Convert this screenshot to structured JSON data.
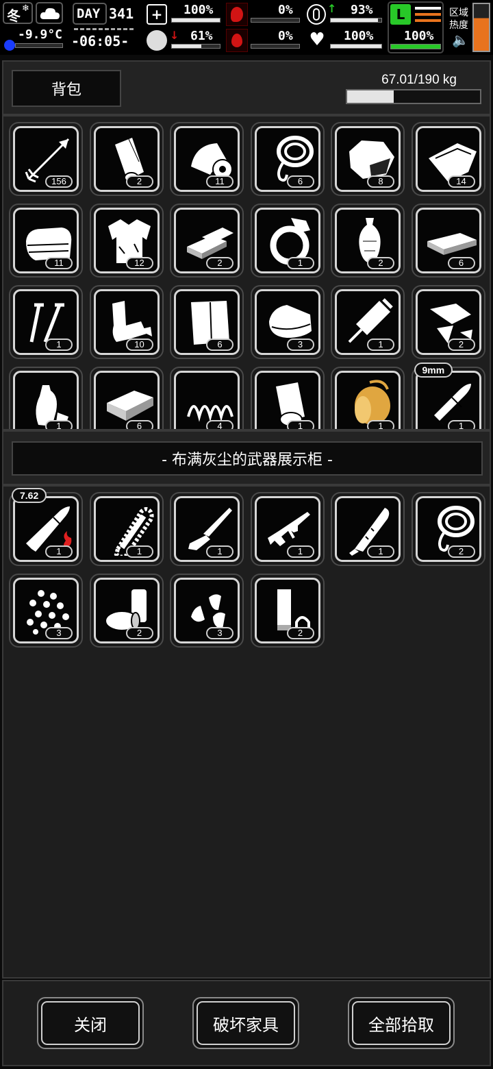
{
  "hud": {
    "season": "冬",
    "temperature": "-9.9°C",
    "day_label": "DAY",
    "day_number": "341",
    "clock": "-06:05-",
    "health_pct": "100%",
    "health_fill": 1.0,
    "hunger_pct": "0%",
    "hunger_fill": 0.0,
    "energy_pct": "93%",
    "energy_fill": 0.93,
    "brain_pct": "61%",
    "brain_fill": 0.61,
    "blood_pct": "0%",
    "blood_fill": 0.0,
    "heart_pct": "100%",
    "heart_fill": 1.0,
    "stamina_pct": "100%",
    "stamina_fill": 1.0,
    "zone_heat_label": "区域热度",
    "colors": {
      "green": "#28c828",
      "red": "#d21414",
      "orange": "#e8731e"
    }
  },
  "backpack": {
    "title": "背包",
    "weight": "67.01/190 kg",
    "weight_fill": 0.3527,
    "items": [
      {
        "icon": "arrow-icon",
        "count": "156"
      },
      {
        "icon": "bandage-roll-icon",
        "count": "2"
      },
      {
        "icon": "duct-tape-icon",
        "count": "11"
      },
      {
        "icon": "rope-icon",
        "count": "6"
      },
      {
        "icon": "ore-icon",
        "count": "8"
      },
      {
        "icon": "paper-stack-icon",
        "count": "14"
      },
      {
        "icon": "cloth-icon",
        "count": "11"
      },
      {
        "icon": "rag-shirt-icon",
        "count": "12"
      },
      {
        "icon": "silver-bar-icon",
        "count": "2"
      },
      {
        "icon": "diamond-ring-icon",
        "count": "1"
      },
      {
        "icon": "vase-icon",
        "count": "2"
      },
      {
        "icon": "cash-stack-icon",
        "count": "6"
      },
      {
        "icon": "screws-icon",
        "count": "1"
      },
      {
        "icon": "scrap-leather-icon",
        "count": "10"
      },
      {
        "icon": "fabric-sheet-icon",
        "count": "6"
      },
      {
        "icon": "towel-icon",
        "count": "3"
      },
      {
        "icon": "syringe-icon",
        "count": "1"
      },
      {
        "icon": "glass-shards-icon",
        "count": "2"
      },
      {
        "icon": "plastic-bottle-icon",
        "count": "1"
      },
      {
        "icon": "brick-icon",
        "count": "6"
      },
      {
        "icon": "spring-icon",
        "count": "4"
      },
      {
        "icon": "paper-roll-icon",
        "count": "1"
      },
      {
        "icon": "gold-spool-icon",
        "count": "1"
      },
      {
        "icon": "bullet-9mm-icon",
        "count": "1",
        "tag": "9mm"
      }
    ]
  },
  "container": {
    "title": "- 布满灰尘的武器展示柜 -",
    "items": [
      {
        "icon": "bullet-762-icon",
        "count": "1",
        "tag": "7.62"
      },
      {
        "icon": "chainsaw-chain-icon",
        "count": "1"
      },
      {
        "icon": "shotgun-icon",
        "count": "1"
      },
      {
        "icon": "assault-rifle-icon",
        "count": "1"
      },
      {
        "icon": "machete-icon",
        "count": "1"
      },
      {
        "icon": "rope-icon",
        "count": "2"
      },
      {
        "icon": "pellets-icon",
        "count": "3"
      },
      {
        "icon": "shell-casings-icon",
        "count": "2"
      },
      {
        "icon": "bullet-tips-icon",
        "count": "3"
      },
      {
        "icon": "shotgun-shell-icon",
        "count": "2"
      }
    ]
  },
  "buttons": {
    "close": "关闭",
    "destroy": "破坏家具",
    "take_all": "全部拾取"
  }
}
